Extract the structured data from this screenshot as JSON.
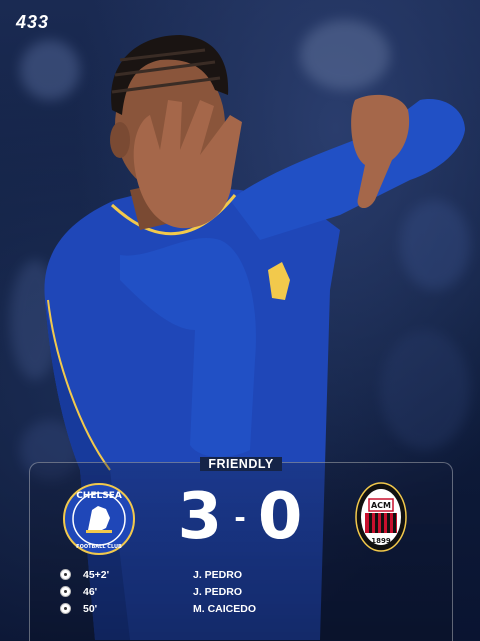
{
  "brand": {
    "logo_text": "433"
  },
  "match": {
    "competition": "FRIENDLY",
    "home_team": "CHELSEA FOOTBALL CLUB",
    "away_team": "ACM 1899",
    "home_score": "3",
    "separator": "-",
    "away_score": "0"
  },
  "goals": [
    {
      "minute": "45+2'",
      "scorer": "J. PEDRO",
      "icon": "soccer-ball-icon"
    },
    {
      "minute": "46'",
      "scorer": "J. PEDRO",
      "icon": "soccer-ball-icon"
    },
    {
      "minute": "50'",
      "scorer": "M. CAICEDO",
      "icon": "soccer-ball-icon"
    }
  ],
  "colors": {
    "chelsea_blue": "#1f47b8",
    "milan_red": "#c8102e",
    "kit_trim": "#f2c94c"
  }
}
